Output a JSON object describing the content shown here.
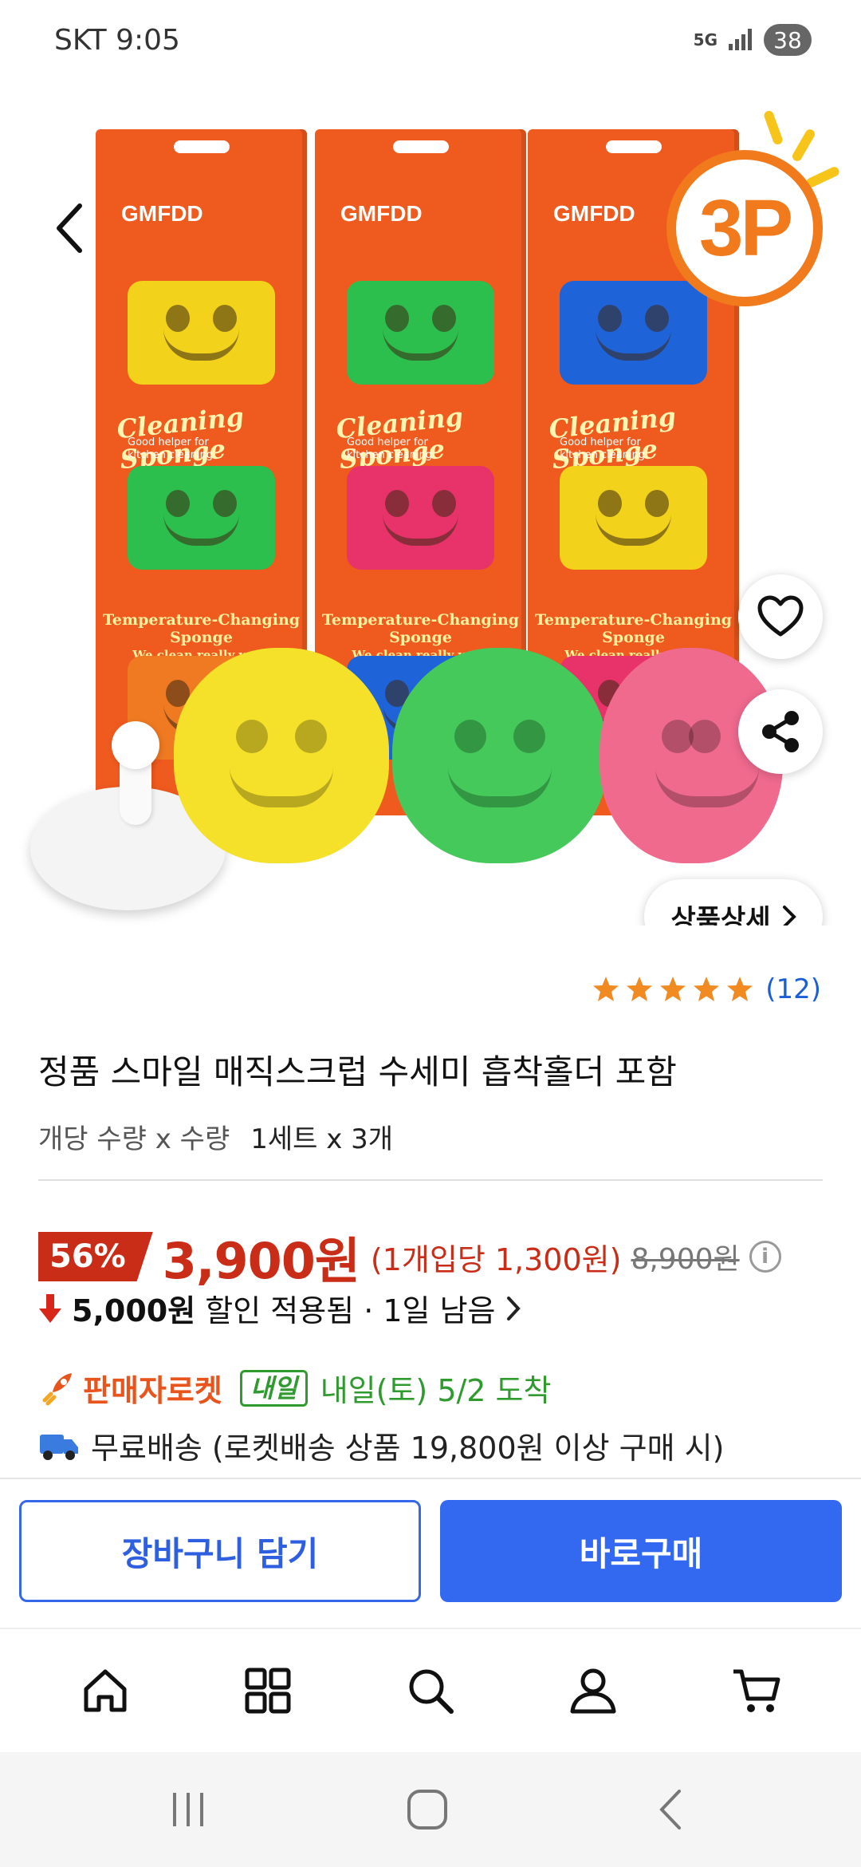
{
  "status_bar": {
    "carrier_time": "SKT 9:05",
    "network": "5G",
    "battery": "38"
  },
  "hero": {
    "badge": "3P",
    "detail_button": "상품상세",
    "boxes": [
      {
        "brand": "GMFDD",
        "title": "Cleaning Sponge",
        "subtitle": "Good helper for kitchen cleaning",
        "temp": "Temperature-Changing Sponge",
        "tagline": "We clean really well.",
        "faces": [
          "#f2d21a",
          "#2dbf4d",
          "#f07a22"
        ]
      },
      {
        "brand": "GMFDD",
        "title": "Cleaning Sponge",
        "subtitle": "Good helper for kitchen cleaning",
        "temp": "Temperature-Changing Sponge",
        "tagline": "We clean really well.",
        "faces": [
          "#2dbf4d",
          "#e8336a",
          "#1f63d8"
        ]
      },
      {
        "brand": "GMFDD",
        "title": "Cleaning Sponge",
        "subtitle": "Good helper for kitchen cleaning",
        "temp": "Temperature-Changing Sponge",
        "tagline": "We clean really well.",
        "faces": [
          "#1f63d8",
          "#f2d21a",
          "#e8336a"
        ]
      }
    ],
    "sponges": [
      "#f5e02a",
      "#44c95a",
      "#f06a8e"
    ],
    "pagination": {
      "total": 5,
      "active": 1
    }
  },
  "product": {
    "rating": 5,
    "review_count": "(12)",
    "name": "정품 스마일 매직스크럽 수세미 흡착홀더 포함",
    "option_label": "개당 수량 x 수량",
    "option_value": "1세트 x 3개"
  },
  "price": {
    "discount": "56%",
    "sale_price": "3,900원",
    "unit_price": "(1개입당 1,300원)",
    "original_price": "8,900원",
    "coupon_amount": "5,000원",
    "coupon_text": "할인 적용됨 · 1일 남음"
  },
  "shipping": {
    "seller_rocket": "판매자로켓",
    "tomorrow_badge": "내일",
    "arrival": "내일(토) 5/2 도착",
    "free_shipping": "무료배송 (로켓배송 상품 19,800원 이상 구매 시)"
  },
  "actions": {
    "cart": "장바구니 담기",
    "buy": "바로구매"
  },
  "colors": {
    "accent_blue": "#3369f0",
    "sale_red": "#c92c17",
    "rocket_orange": "#e8541c",
    "green": "#2f9b2f",
    "box_orange": "#ef5a1e"
  },
  "bottom_nav": [
    "home-icon",
    "categories-icon",
    "search-icon",
    "profile-icon",
    "cart-icon"
  ],
  "system_nav": [
    "recent-apps-icon",
    "home-button-icon",
    "back-icon"
  ]
}
